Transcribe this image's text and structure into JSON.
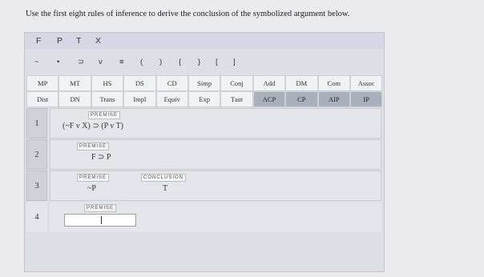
{
  "instructions": "Use the first eight rules of inference to derive the conclusion of the symbolized argument below.",
  "toolbar": {
    "variables": [
      "F",
      "P",
      "T",
      "X"
    ],
    "symbols": [
      "~",
      "•",
      "⊃",
      "v",
      "≡",
      "(",
      ")",
      "{",
      "}",
      "[",
      "]"
    ]
  },
  "rules": [
    [
      "MP",
      "MT",
      "HS",
      "DS",
      "CD",
      "Simp",
      "Conj",
      "Add",
      "DM",
      "Com",
      "Assoc"
    ],
    [
      "Dist",
      "DN",
      "Trans",
      "Impl",
      "Equiv",
      "Exp",
      "Taut",
      "ACP",
      "CP",
      "AIP",
      "IP"
    ]
  ],
  "proof_lines": [
    {
      "number": "1",
      "tag": "PREMISE",
      "formula": "(~F v X) ⊃ (P v T)"
    },
    {
      "number": "2",
      "tag": "PREMISE",
      "formula": "F ⊃ P"
    },
    {
      "number": "3",
      "tag": "PREMISE",
      "formula": "~P",
      "conclusion_tag": "CONCLUSION",
      "conclusion": "T"
    },
    {
      "number": "4",
      "tag": "PREMISE",
      "formula": ""
    }
  ]
}
